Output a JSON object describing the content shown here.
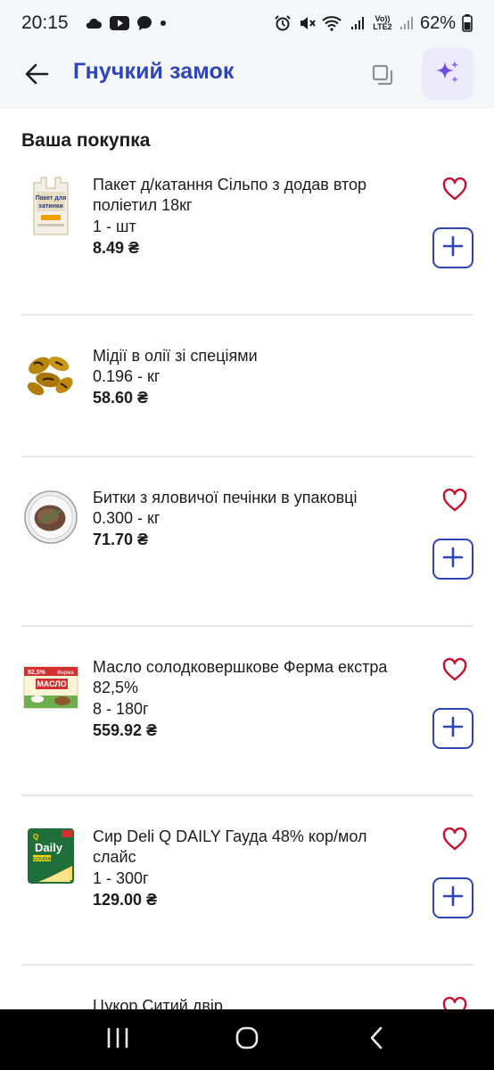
{
  "status_bar": {
    "time": "20:15",
    "network": "Vo)) LTE2",
    "battery": "62%"
  },
  "header": {
    "title": "Гнучкий замок",
    "back_icon": "arrow-left-icon",
    "copy_icon": "copy-icon",
    "ai_icon": "sparkles-icon"
  },
  "section": {
    "title": "Ваша покупка"
  },
  "colors": {
    "accent": "#2f45b7",
    "heart": "#c8102e",
    "ai_bg": "#ece9fb",
    "divider": "#e6e7ea"
  },
  "items": [
    {
      "name": "Пакет д/катання Сільпо з додав втор поліетил 18кг",
      "qty": "1 - шт",
      "price": "8.49 ₴",
      "image": "plastic-bag-image",
      "has_heart": true,
      "has_add": true
    },
    {
      "name": "Мідії в олії зі спеціями",
      "qty": "0.196 - кг",
      "price": "58.60 ₴",
      "image": "mussels-image",
      "has_heart": false,
      "has_add": false
    },
    {
      "name": "Битки з яловичої печінки в упаковці",
      "qty": "0.300 - кг",
      "price": "71.70 ₴",
      "image": "liver-patties-image",
      "has_heart": true,
      "has_add": true
    },
    {
      "name": "Масло солодковершкове Ферма екстра 82,5%",
      "qty": "8 - 180г",
      "price": "559.92 ₴",
      "image": "butter-image",
      "has_heart": true,
      "has_add": true
    },
    {
      "name": "Сир Deli Q DAILY Гауда 48% кор/мол слайс",
      "qty": "1 - 300г",
      "price": "129.00 ₴",
      "image": "cheese-image",
      "has_heart": true,
      "has_add": true
    },
    {
      "name": "Цукор Ситий двір",
      "image": "sugar-image",
      "has_heart": true
    }
  ]
}
